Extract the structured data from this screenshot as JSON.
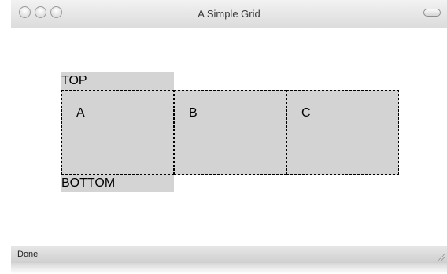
{
  "window": {
    "title": "A Simple Grid"
  },
  "grid": {
    "top_label": "TOP",
    "bottom_label": "BOTTOM",
    "cells": [
      "A",
      "B",
      "C"
    ]
  },
  "status_bar": {
    "text": "Done"
  },
  "colors": {
    "cell_background": "#d3d3d3",
    "label_background": "#d4d4d4",
    "cell_border": "#000000"
  }
}
